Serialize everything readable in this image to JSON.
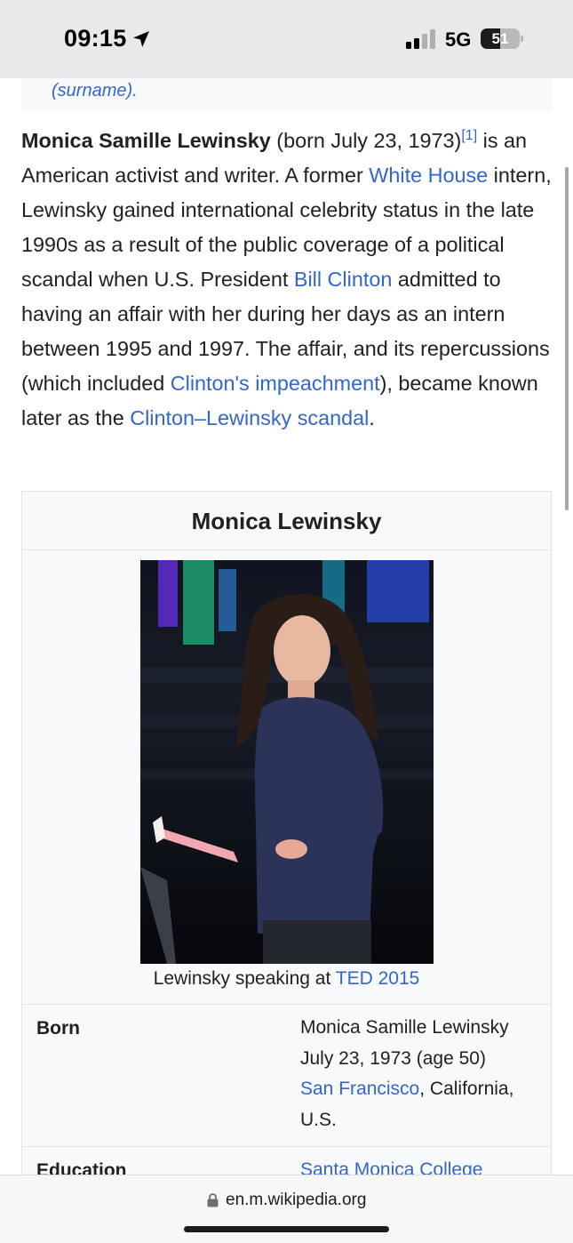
{
  "status_bar": {
    "time": "09:15",
    "network": "5G",
    "battery_level": "51",
    "battery_fraction": 0.51
  },
  "hatnote": {
    "text": "(surname)."
  },
  "lead": {
    "name_bold": "Monica Samille Lewinsky",
    "t1": " (born July 23, 1973)",
    "ref": "[1]",
    "t2": " is an American activist and writer. A former ",
    "link_white_house": "White House",
    "t3": " intern, Lewinsky gained international celebrity status in the late 1990s as a result of the public coverage of a political scandal when U.S. President ",
    "link_bill_clinton": "Bill Clinton",
    "t4": " admitted to having an affair with her during her days as an intern between 1995 and 1997. The affair, and its repercussions (which included ",
    "link_impeachment": "Clinton's impeachment",
    "t5": "), became known later as the ",
    "link_scandal": "Clinton–Lewinsky scandal",
    "t6": "."
  },
  "infobox": {
    "title": "Monica Lewinsky",
    "caption_text": "Lewinsky speaking at ",
    "caption_link": "TED 2015",
    "born_label": "Born",
    "born_name": "Monica Samille Lewinsky",
    "born_date": "July 23, 1973 (age 50)",
    "born_place_link": "San Francisco",
    "born_place_rest": ", California, U.S.",
    "education_label": "Education",
    "education_value": "Santa Monica College"
  },
  "browser": {
    "url": "en.m.wikipedia.org"
  },
  "colors": {
    "link": "#3366cc",
    "text": "#202122",
    "infobox_bg": "#f8f9fa"
  }
}
